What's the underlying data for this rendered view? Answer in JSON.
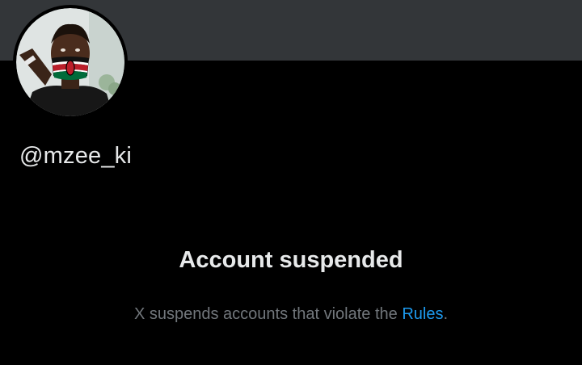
{
  "profile": {
    "handle": "@mzee_ki",
    "avatar_description_icon": "profile-photo"
  },
  "suspension": {
    "title": "Account suspended",
    "message_prefix": "X suspends accounts that violate the ",
    "rules_link": "Rules",
    "message_suffix": "."
  },
  "colors": {
    "background": "#000000",
    "banner": "#333639",
    "primary_text": "#e7e9ea",
    "secondary_text": "#71767b",
    "link": "#1d9bf0"
  }
}
